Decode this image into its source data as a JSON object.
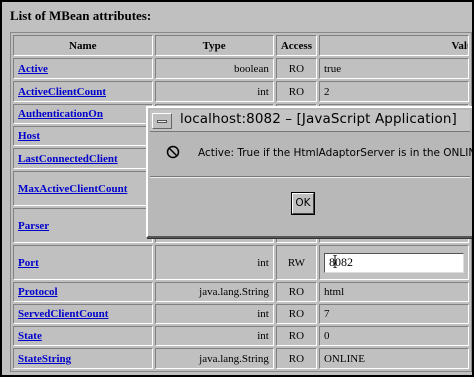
{
  "heading": "List of MBean attributes:",
  "columns": {
    "name": "Name",
    "type": "Type",
    "access": "Access",
    "value": "Value"
  },
  "rows": [
    {
      "name": "Active",
      "type": "boolean",
      "access": "RO",
      "value": "true"
    },
    {
      "name": "ActiveClientCount",
      "type": "int",
      "access": "RO",
      "value": "2"
    },
    {
      "name": "AuthenticationOn",
      "type": "",
      "access": "",
      "value": ""
    },
    {
      "name": "Host",
      "type": "",
      "access": "",
      "value": ""
    },
    {
      "name": "LastConnectedClient",
      "type": "",
      "access": "",
      "value": ""
    },
    {
      "name": "MaxActiveClientCount",
      "type": "",
      "access": "",
      "value": ""
    },
    {
      "name": "Parser",
      "type": "",
      "access": "",
      "value": ""
    },
    {
      "name": "Port",
      "type": "int",
      "access": "RW",
      "value": "8082",
      "editable": true
    },
    {
      "name": "Protocol",
      "type": "java.lang.String",
      "access": "RO",
      "value": "html"
    },
    {
      "name": "ServedClientCount",
      "type": "int",
      "access": "RO",
      "value": "7"
    },
    {
      "name": "State",
      "type": "int",
      "access": "RO",
      "value": "0"
    },
    {
      "name": "StateString",
      "type": "java.lang.String",
      "access": "RO",
      "value": "ONLINE"
    }
  ],
  "dialog": {
    "title": "localhost:8082 – [JavaScript Application]",
    "message": "Active: True if the HtmlAdaptorServer is in the ONLINE state.",
    "ok_label": "OK",
    "icon": "stop-icon"
  },
  "colors": {
    "link": "#0000cc",
    "window_bg": "#c0c0c0",
    "input_bg": "#ffffff"
  }
}
